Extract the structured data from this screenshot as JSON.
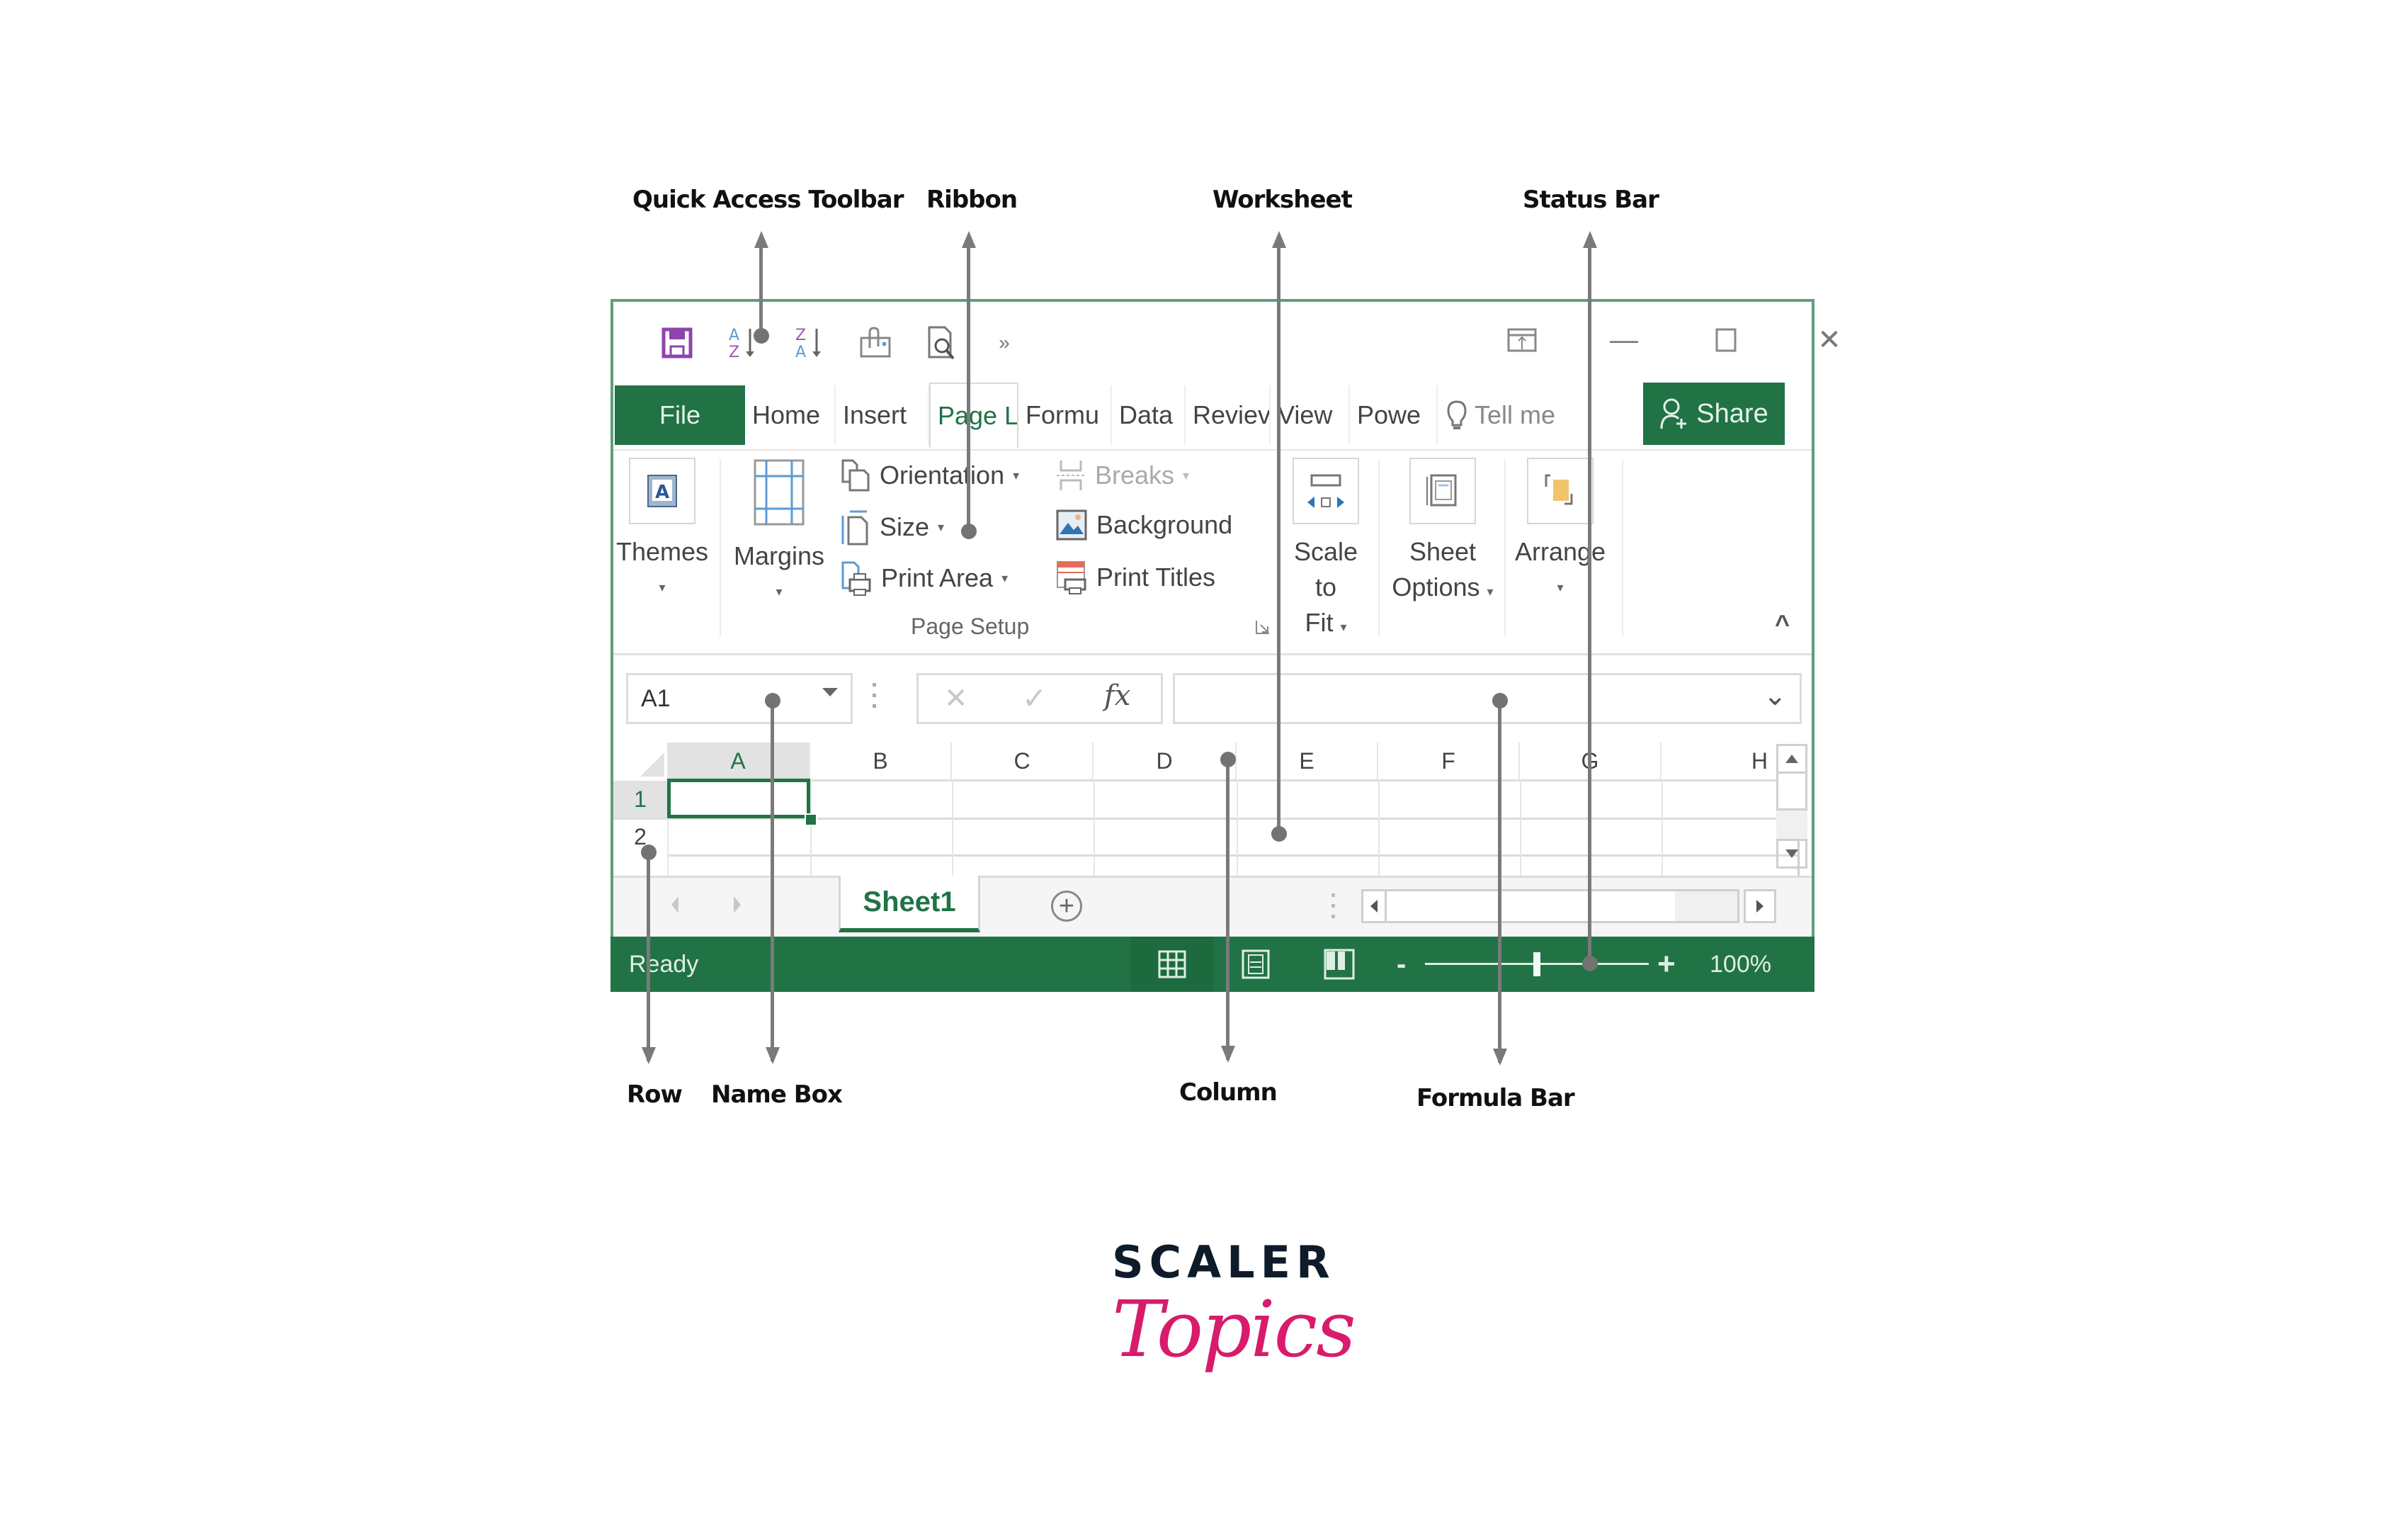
{
  "annotations": {
    "top": [
      "Quick Access Toolbar",
      "Ribbon",
      "Worksheet",
      "Status Bar"
    ],
    "bottom": [
      "Row",
      "Name Box",
      "Column",
      "Formula Bar"
    ]
  },
  "quick_access_toolbar": {
    "icons": [
      "save-icon",
      "sort-a-to-z-icon",
      "sort-z-to-a-icon",
      "attach-icon",
      "print-preview-icon",
      "more-commands-icon"
    ],
    "more_glyph": "»"
  },
  "window_controls": {
    "ribbon_display": "ribbon-display-options-icon",
    "minimize": "—",
    "maximize": "☐",
    "close": "✕"
  },
  "tabs": [
    {
      "label": "File",
      "type": "file"
    },
    {
      "label": "Home"
    },
    {
      "label": "Insert"
    },
    {
      "label": "Page L",
      "active": true
    },
    {
      "label": "Formu"
    },
    {
      "label": "Data"
    },
    {
      "label": "Reviev"
    },
    {
      "label": "View"
    },
    {
      "label": "Powe"
    }
  ],
  "tell_me": "Tell me",
  "share_label": "Share",
  "ribbon": {
    "themes_label": "Themes",
    "margins_label": "Margins",
    "orientation_label": "Orientation",
    "size_label": "Size",
    "print_area_label": "Print Area",
    "breaks_label": "Breaks",
    "background_label": "Background",
    "print_titles_label": "Print Titles",
    "group_label": "Page Setup",
    "scale_to_fit_label_1": "Scale to",
    "scale_to_fit_label_2": "Fit",
    "sheet_options_label_1": "Sheet",
    "sheet_options_label_2": "Options",
    "arrange_label": "Arrange",
    "caret": "▾",
    "collapse_glyph": "^"
  },
  "formula_bar": {
    "name_box_value": "A1",
    "cancel_glyph": "✕",
    "enter_glyph": "✓",
    "fx_glyph": "fx",
    "formula_value": "",
    "expand_glyph": "⌄"
  },
  "grid": {
    "columns": [
      "A",
      "B",
      "C",
      "D",
      "E",
      "F",
      "G",
      "H"
    ],
    "rows": [
      "1",
      "2"
    ],
    "selected_cell": "A1"
  },
  "sheets": {
    "tabs": [
      "Sheet1"
    ],
    "active": "Sheet1",
    "add_glyph": "+"
  },
  "status_bar": {
    "status_text": "Ready",
    "zoom_minus": "-",
    "zoom_plus": "+",
    "zoom_value": "100%",
    "zoom_level_percent": 100
  },
  "logo": {
    "top": "SCALER",
    "bottom": "Topics"
  },
  "colors": {
    "excel_green": "#217346",
    "annotation_gray": "#7a7a7a",
    "logo_navy": "#0d1b2a",
    "logo_pink": "#d81b6a"
  }
}
